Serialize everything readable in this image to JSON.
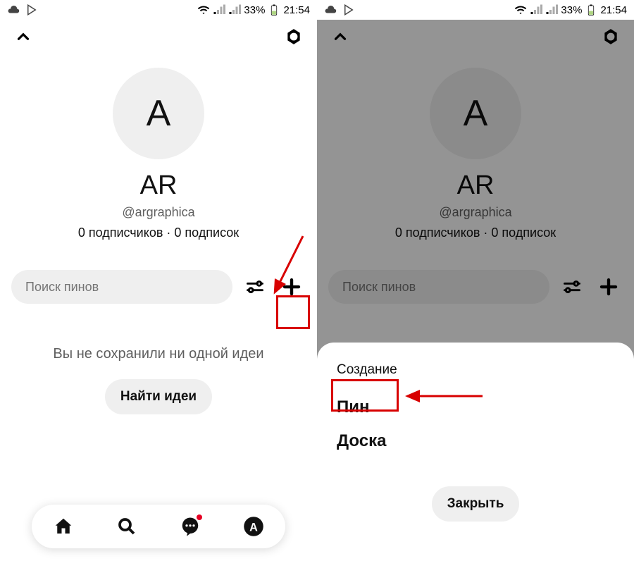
{
  "statusbar": {
    "battery_pct": "33%",
    "time": "21:54"
  },
  "profile": {
    "avatar_letter": "A",
    "display_name": "AR",
    "handle": "@argraphica",
    "stats": "0 подписчиков · 0 подписок"
  },
  "search": {
    "placeholder": "Поиск пинов"
  },
  "empty": {
    "message": "Вы не сохранили ни одной идеи",
    "cta": "Найти идеи"
  },
  "sheet": {
    "title": "Создание",
    "item_pin": "Пин",
    "item_board": "Доска",
    "close": "Закрыть"
  }
}
